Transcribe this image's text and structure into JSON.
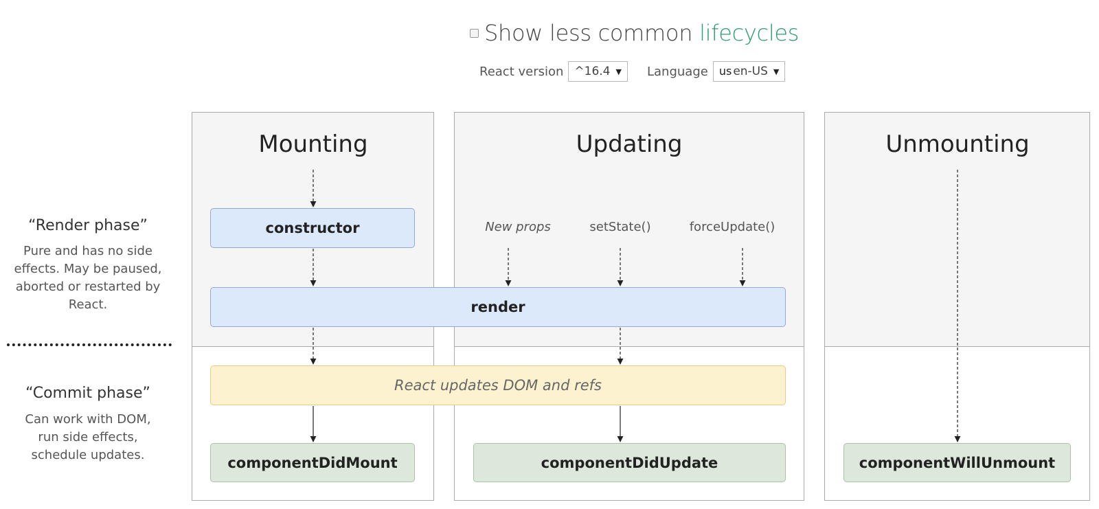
{
  "header": {
    "toggle_label_prefix": "Show less common ",
    "toggle_label_highlight": "lifecycles",
    "react_version_label": "React version",
    "react_version_value": "^16.4",
    "language_label": "Language",
    "language_flag": "us",
    "language_value": "en-US"
  },
  "phases": {
    "render": {
      "title": "“Render phase”",
      "description": "Pure and has no side\neffects. May be paused,\naborted or restarted by\nReact."
    },
    "commit": {
      "title": "“Commit phase”",
      "description": "Can work with DOM,\nrun side effects,\nschedule updates."
    }
  },
  "columns": {
    "mounting": "Mounting",
    "updating": "Updating",
    "unmounting": "Unmounting"
  },
  "nodes": {
    "constructor": "constructor",
    "render": "render",
    "dom_update": "React updates DOM and refs",
    "did_mount": "componentDidMount",
    "did_update": "componentDidUpdate",
    "will_unmount": "componentWillUnmount"
  },
  "triggers": {
    "new_props": "New props",
    "set_state": "setState()",
    "force_update": "forceUpdate()"
  },
  "colors": {
    "render_box": "#dce9fb",
    "commit_box": "#fdf2cf",
    "lifecycle_box": "#dee7dc",
    "highlight": "#2a9d6e"
  }
}
